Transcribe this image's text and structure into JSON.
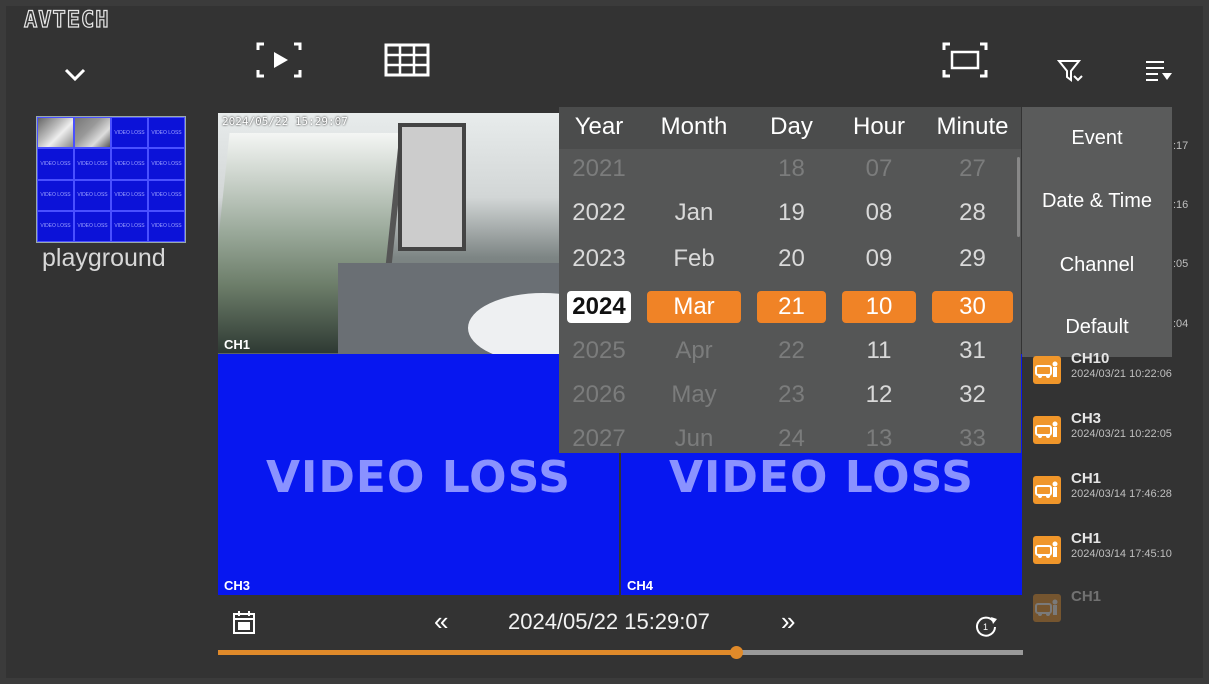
{
  "header": {
    "logo": "AVTECH",
    "icons": [
      "chevron-down-icon",
      "playback-icon",
      "grid-layout-icon",
      "fullscreen-icon",
      "filter-icon",
      "sort-list-icon"
    ]
  },
  "thumbnail": {
    "label": "playground",
    "cell_text": "VIDEO LOSS"
  },
  "video_grid": {
    "timestamp": "2024/05/22 15:29:07",
    "tiles": [
      {
        "label": "CH1"
      },
      {
        "label": "CH3",
        "status": "VIDEO LOSS"
      },
      {
        "label": "CH4",
        "status": "VIDEO LOSS"
      }
    ]
  },
  "date_picker": {
    "columns": [
      {
        "title": "Year",
        "values": [
          "2021",
          "2022",
          "2023",
          "2024",
          "2025",
          "2026",
          "2027"
        ],
        "selected": "2024"
      },
      {
        "title": "Month",
        "values": [
          "",
          "Jan",
          "Feb",
          "Mar",
          "Apr",
          "May",
          "Jun"
        ],
        "selected": "Mar"
      },
      {
        "title": "Day",
        "values": [
          "18",
          "19",
          "20",
          "21",
          "22",
          "23",
          "24"
        ],
        "selected": "21"
      },
      {
        "title": "Hour",
        "values": [
          "07",
          "08",
          "09",
          "10",
          "11",
          "12",
          "13"
        ],
        "selected": "10"
      },
      {
        "title": "Minute",
        "values": [
          "27",
          "28",
          "29",
          "30",
          "31",
          "32",
          "33"
        ],
        "selected": "30"
      }
    ]
  },
  "menu": {
    "items": [
      "Event",
      "Date & Time",
      "Channel",
      "Default"
    ]
  },
  "events": {
    "partial_times": [
      ":17",
      ":16",
      ":05",
      ":04"
    ],
    "items": [
      {
        "channel": "CH10",
        "time": "2024/03/21 10:22:06"
      },
      {
        "channel": "CH3",
        "time": "2024/03/21 10:22:05"
      },
      {
        "channel": "CH1",
        "time": "2024/03/14 17:46:28"
      },
      {
        "channel": "CH1",
        "time": "2024/03/14 17:45:10"
      },
      {
        "channel": "CH1",
        "time": ""
      }
    ]
  },
  "playback": {
    "timestamp": "2024/05/22 15:29:07",
    "rewind_label": "«",
    "forward_label": "»",
    "progress_fraction": 0.644,
    "colors": {
      "accent": "#f08326",
      "video_loss_blue": "#0717f0"
    }
  }
}
